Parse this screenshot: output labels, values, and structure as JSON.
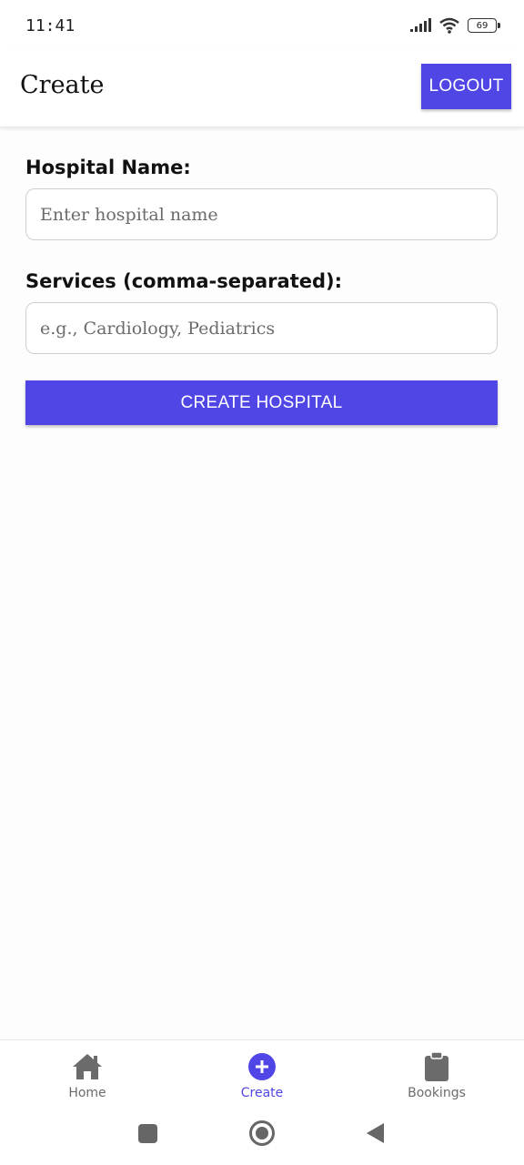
{
  "status_bar": {
    "time": "11:41",
    "battery": "69"
  },
  "header": {
    "title": "Create",
    "logout_label": "LOGOUT"
  },
  "form": {
    "hospital_name_label": "Hospital Name:",
    "hospital_name_placeholder": "Enter hospital name",
    "hospital_name_value": "",
    "services_label": "Services (comma-separated):",
    "services_placeholder": "e.g., Cardiology, Pediatrics",
    "services_value": "",
    "submit_label": "CREATE HOSPITAL"
  },
  "bottom_nav": {
    "items": [
      {
        "label": "Home",
        "icon": "home-icon",
        "active": false
      },
      {
        "label": "Create",
        "icon": "plus-circle-icon",
        "active": true
      },
      {
        "label": "Bookings",
        "icon": "clipboard-icon",
        "active": false
      }
    ]
  },
  "colors": {
    "primary": "#4f46e5",
    "inactive": "#6b6b6b"
  }
}
